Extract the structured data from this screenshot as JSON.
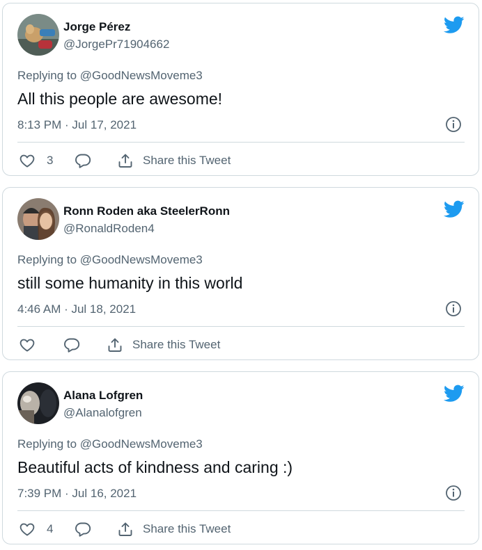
{
  "colors": {
    "twitter_blue": "#1d9bf0",
    "name_text": "#0f1419",
    "secondary_text": "#536471",
    "border": "#cfd9de"
  },
  "icons": {
    "brand": "twitter-bird-icon",
    "info": "info-icon",
    "like": "heart-icon",
    "reply": "comment-icon",
    "share": "share-icon"
  },
  "tweets": [
    {
      "author_name": "Jorge Pérez",
      "author_handle": "@JorgePr71904662",
      "replying_to": "Replying to @GoodNewsMoveme3",
      "text": "All this people are awesome!",
      "timestamp": "8:13 PM · Jul 17, 2021",
      "likes": "3",
      "share_label": "Share this Tweet"
    },
    {
      "author_name": "Ronn Roden aka SteelerRonn",
      "author_handle": "@RonaldRoden4",
      "replying_to": "Replying to @GoodNewsMoveme3",
      "text": "still some humanity in this world",
      "timestamp": "4:46 AM · Jul 18, 2021",
      "likes": "",
      "share_label": "Share this Tweet"
    },
    {
      "author_name": "Alana Lofgren",
      "author_handle": "@Alanalofgren",
      "replying_to": "Replying to @GoodNewsMoveme3",
      "text": "Beautiful acts of kindness and caring :)",
      "timestamp": "7:39 PM · Jul 16, 2021",
      "likes": "4",
      "share_label": "Share this Tweet"
    }
  ]
}
